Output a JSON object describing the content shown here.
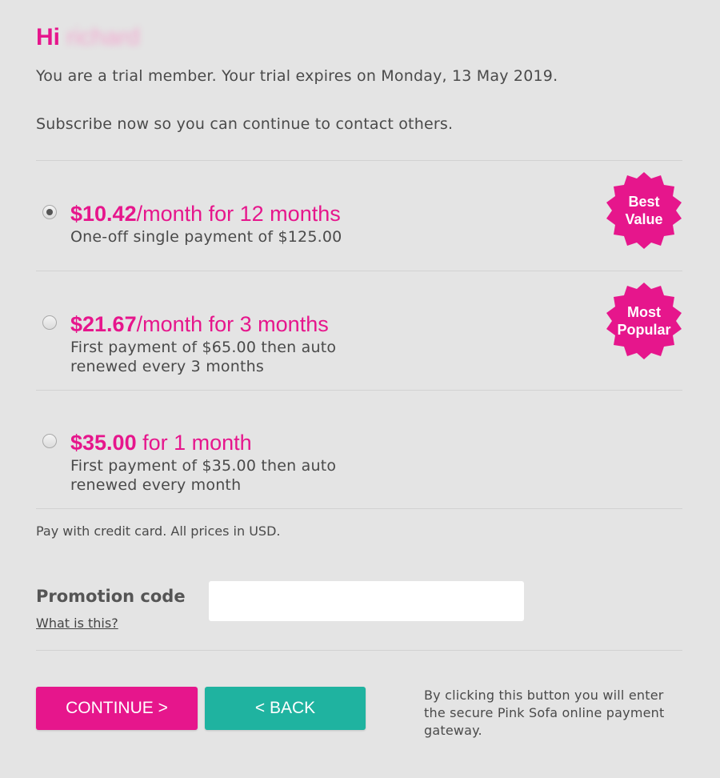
{
  "greeting": {
    "prefix": "Hi",
    "username": "richard"
  },
  "intro": {
    "line1": "You are a trial member. Your trial expires on Monday, 13 May 2019.",
    "line2": "Subscribe now so you can continue to contact others."
  },
  "plans": [
    {
      "price": "$10.42",
      "title_rest": "/month for 12 months",
      "desc": "One-off single payment of $125.00",
      "selected": true,
      "badge": "Best\nValue"
    },
    {
      "price": "$21.67",
      "title_rest": "/month for 3 months",
      "desc": "First payment of $65.00 then auto renewed every 3 months",
      "selected": false,
      "badge": "Most\nPopular"
    },
    {
      "price": "$35.00",
      "title_rest": " for 1 month",
      "desc": "First payment of $35.00 then auto renewed every month",
      "selected": false,
      "badge": ""
    }
  ],
  "pay_note": "Pay with credit card. All prices in USD.",
  "promo": {
    "label": "Promotion code",
    "link": "What is this?",
    "value": "",
    "placeholder": ""
  },
  "buttons": {
    "continue": "CONTINUE >",
    "back": "< BACK"
  },
  "secure_note": "By clicking this button you will enter the secure Pink Sofa online payment gateway.",
  "colors": {
    "accent": "#e6168c",
    "teal": "#1fb3a0",
    "background": "#e4e4e4"
  }
}
